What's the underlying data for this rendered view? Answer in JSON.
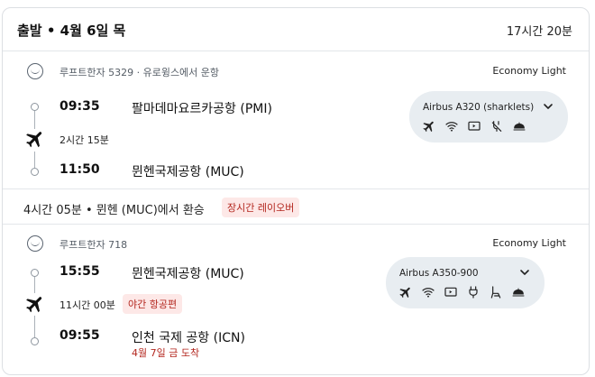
{
  "header": {
    "title": "출발 • 4월 6일 목",
    "total_duration": "17시간 20분"
  },
  "segments": [
    {
      "airline": "루프트한자 5329 · 유로윙스에서 운항",
      "cabin": "Economy Light",
      "departure_time": "09:35",
      "departure_airport": "팔마데마요르카공항 (PMI)",
      "duration": "2시간 15분",
      "arrival_time": "11:50",
      "arrival_airport": "뮌헨국제공항 (MUC)",
      "aircraft": "Airbus A320 (sharklets)",
      "amenities": [
        "plane-icon",
        "wifi-icon",
        "entertainment-icon",
        "no-power-icon",
        "meal-icon"
      ]
    },
    {
      "airline": "루프트한자 718",
      "cabin": "Economy Light",
      "departure_time": "15:55",
      "departure_airport": "뮌헨국제공항 (MUC)",
      "duration": "11시간 00분",
      "duration_badge": "야간 항공편",
      "arrival_time": "09:55",
      "arrival_airport": "인천 국제 공항 (ICN)",
      "arrival_note": "4월 7일 금 도착",
      "aircraft": "Airbus A350-900",
      "amenities": [
        "plane-icon",
        "wifi-icon",
        "entertainment-icon",
        "power-icon",
        "seat-icon",
        "meal-icon"
      ]
    }
  ],
  "layover": {
    "text": "4시간 05분  •  뮌헨 (MUC)에서 환승",
    "badge": "장시간 레이오버"
  },
  "colors": {
    "warning_text": "#b3261e",
    "warning_bg": "#fde8e7",
    "aircraft_box_bg": "#e8edf1",
    "border": "#dcdfe3"
  }
}
